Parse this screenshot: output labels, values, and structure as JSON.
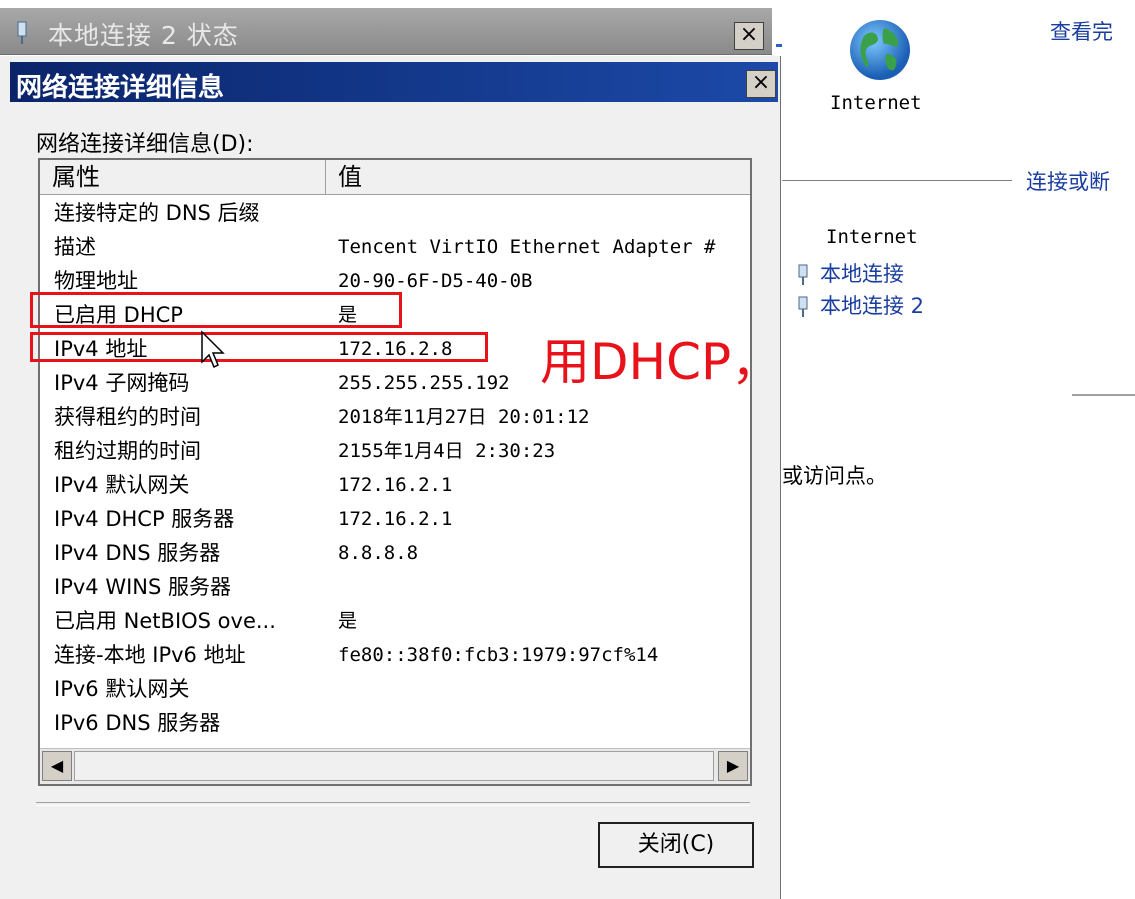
{
  "background_window": {
    "title": "本地连接 2 状态",
    "close_glyph": "×"
  },
  "dialog": {
    "title": "网络连接详细信息",
    "close_glyph": "×",
    "list_label": "网络连接详细信息(D):",
    "columns": {
      "property": "属性",
      "value": "值"
    },
    "rows": [
      {
        "property": "连接特定的 DNS 后缀",
        "value": ""
      },
      {
        "property": "描述",
        "value": "Tencent VirtIO Ethernet Adapter #"
      },
      {
        "property": "物理地址",
        "value": "20-90-6F-D5-40-0B"
      },
      {
        "property": "已启用 DHCP",
        "value": "是"
      },
      {
        "property": "IPv4 地址",
        "value": "172.16.2.8"
      },
      {
        "property": "IPv4 子网掩码",
        "value": "255.255.255.192"
      },
      {
        "property": "获得租约的时间",
        "value": "2018年11月27日 20:01:12"
      },
      {
        "property": "租约过期的时间",
        "value": "2155年1月4日 2:30:23"
      },
      {
        "property": "IPv4 默认网关",
        "value": "172.16.2.1"
      },
      {
        "property": "IPv4 DHCP 服务器",
        "value": "172.16.2.1"
      },
      {
        "property": "IPv4 DNS 服务器",
        "value": "8.8.8.8"
      },
      {
        "property": "IPv4 WINS 服务器",
        "value": ""
      },
      {
        "property": "已启用 NetBIOS ove...",
        "value": "是"
      },
      {
        "property": "连接-本地 IPv6 地址",
        "value": "fe80::38f0:fcb3:1979:97cf%14"
      },
      {
        "property": "IPv6 默认网关",
        "value": ""
      },
      {
        "property": "IPv6 DNS 服务器",
        "value": ""
      }
    ],
    "scroll_left_glyph": "◀",
    "scroll_right_glyph": "▶",
    "close_button": "关闭(C)"
  },
  "annotation": "用DHCP，自动识别IP",
  "right_panel": {
    "view_full_link": "查看完",
    "globe_caption": "Internet",
    "connect_link": "连接或断",
    "network_name": "Internet",
    "connections": [
      "本地连接",
      "本地连接 2"
    ],
    "access_text": "或访问点。"
  },
  "colors": {
    "highlight_red": "#e8121a",
    "link_blue": "#1a3ea0",
    "title_blue": "#0a246a"
  },
  "icons": [
    "network-adapter-icon",
    "globe-icon",
    "mouse-cursor-icon",
    "close-icon"
  ]
}
